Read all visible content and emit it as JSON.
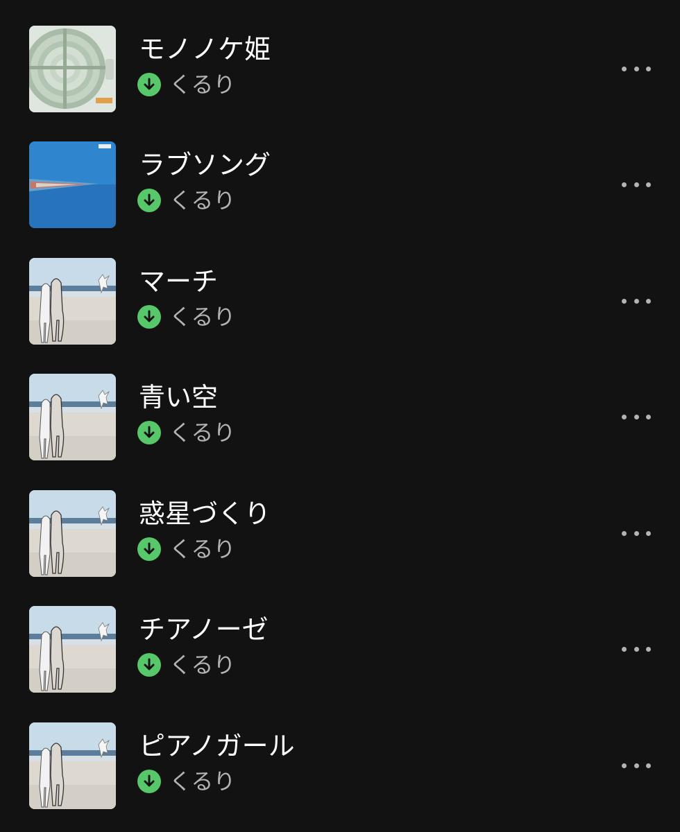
{
  "colors": {
    "background": "#121212",
    "title": "#ffffff",
    "subtitle": "#b3b3b3",
    "download_badge": "#57c86a"
  },
  "tracks": [
    {
      "title": "モノノケ姫",
      "artist": "くるり",
      "downloaded": true,
      "cover": "fan-cover",
      "more_icon": "more-horizontal-icon"
    },
    {
      "title": "ラブソング",
      "artist": "くるり",
      "downloaded": true,
      "cover": "blue-horizon-cover",
      "more_icon": "more-horizontal-icon"
    },
    {
      "title": "マーチ",
      "artist": "くるり",
      "downloaded": true,
      "cover": "beach-cover",
      "more_icon": "more-horizontal-icon"
    },
    {
      "title": "青い空",
      "artist": "くるり",
      "downloaded": true,
      "cover": "beach-cover",
      "more_icon": "more-horizontal-icon"
    },
    {
      "title": "惑星づくり",
      "artist": "くるり",
      "downloaded": true,
      "cover": "beach-cover",
      "more_icon": "more-horizontal-icon"
    },
    {
      "title": "チアノーゼ",
      "artist": "くるり",
      "downloaded": true,
      "cover": "beach-cover",
      "more_icon": "more-horizontal-icon"
    },
    {
      "title": "ピアノガール",
      "artist": "くるり",
      "downloaded": true,
      "cover": "beach-cover",
      "more_icon": "more-horizontal-icon"
    }
  ]
}
